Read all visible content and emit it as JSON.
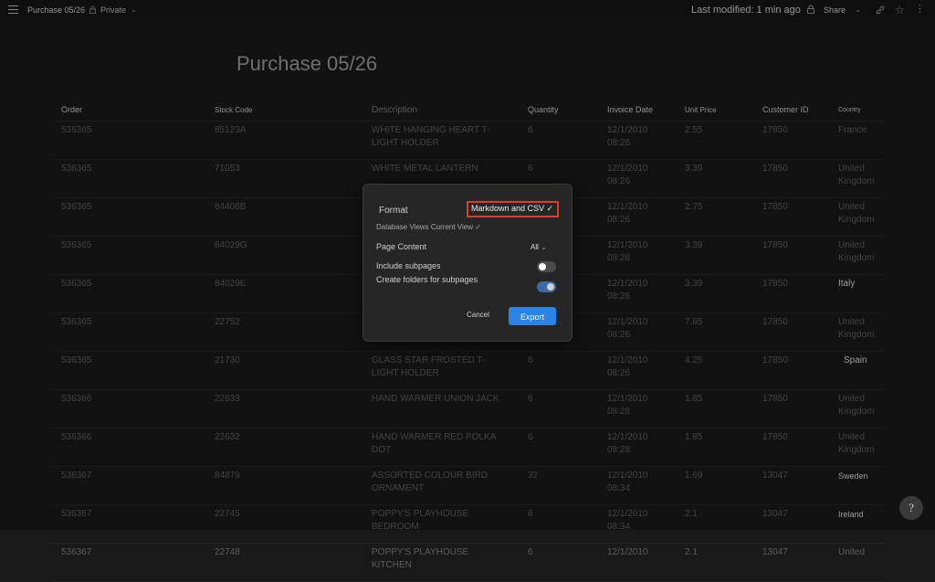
{
  "topbar": {
    "breadcrumb": "Purchase 05/26",
    "privacy": "Private",
    "last_modified": "Last modified: 1 min ago",
    "share_label": "Share",
    "icons": [
      "menu-icon",
      "lock-icon",
      "chevron-down-icon",
      "share-lock-icon",
      "link-icon",
      "star-icon",
      "more-icon"
    ]
  },
  "page": {
    "title": "Purchase 05/26"
  },
  "table": {
    "headers": [
      "Order",
      "Stock Code",
      "Description",
      "Quantity",
      "Invoice Date",
      "Unit Price",
      "Customer ID",
      "Country"
    ],
    "rows": [
      {
        "order": "536365",
        "code": "85123A",
        "desc": "WHITE HANGING HEART T-LIGHT HOLDER",
        "qty": "6",
        "date": "12/1/2010 08:26",
        "price": "2.55",
        "cust": "17850",
        "country": "France"
      },
      {
        "order": "536365",
        "code": "71053",
        "desc": "WHITE METAL LANTERN",
        "qty": "6",
        "date": "12/1/2010 08:26",
        "price": "3.39",
        "cust": "17850",
        "country": "United Kingdom"
      },
      {
        "order": "536365",
        "code": "84406B",
        "desc": "",
        "qty": "",
        "date": "12/1/2010 08:26",
        "price": "2.75",
        "cust": "17850",
        "country": "United Kingdom"
      },
      {
        "order": "536365",
        "code": "84029G",
        "desc": "",
        "qty": "",
        "date": "12/1/2010 08:26",
        "price": "3.39",
        "cust": "17850",
        "country": "United Kingdom"
      },
      {
        "order": "536365",
        "code": "84029E",
        "desc": "",
        "qty": "",
        "date": "12/1/2010 08:26",
        "price": "3.39",
        "cust": "17850",
        "country": "Italy"
      },
      {
        "order": "536365",
        "code": "22752",
        "desc": "",
        "qty": "",
        "date": "12/1/2010 08:26",
        "price": "7.65",
        "cust": "17850",
        "country": "United Kingdom"
      },
      {
        "order": "536365",
        "code": "21730",
        "desc": "GLASS STAR FROSTED T-LIGHT HOLDER",
        "qty": "6",
        "date": "12/1/2010 08:26",
        "price": "4.25",
        "cust": "17850",
        "country": "Spain"
      },
      {
        "order": "536366",
        "code": "22633",
        "desc": "HAND WARMER UNION JACK",
        "qty": "6",
        "date": "12/1/2010 08:28",
        "price": "1.85",
        "cust": "17850",
        "country": "United Kingdom"
      },
      {
        "order": "536366",
        "code": "22632",
        "desc": "HAND WARMER RED POLKA DOT",
        "qty": "6",
        "date": "12/1/2010 08:28",
        "price": "1.85",
        "cust": "17850",
        "country": "United Kingdom"
      },
      {
        "order": "536367",
        "code": "84879",
        "desc": "ASSORTED COLOUR BIRD ORNAMENT",
        "qty": "32",
        "date": "12/1/2010 08:34",
        "price": "1.69",
        "cust": "13047",
        "country": "Sweden"
      },
      {
        "order": "536367",
        "code": "22745",
        "desc": "POPPY'S PLAYHOUSE BEDROOM",
        "qty": "6",
        "date": "12/1/2010 08:34",
        "price": "2.1",
        "cust": "13047",
        "country": "Ireland"
      },
      {
        "order": "536367",
        "code": "22748",
        "desc": "POPPY'S PLAYHOUSE KITCHEN",
        "qty": "6",
        "date": "12/1/2010",
        "price": "2.1",
        "cust": "13047",
        "country": "United"
      }
    ]
  },
  "export_dialog": {
    "format_label": "Format",
    "format_value": "Markdown and CSV",
    "database_views": "Database Views Current View",
    "page_content_label": "Page Content",
    "page_content_value": "All",
    "include_subpages_label": "Include subpages",
    "include_subpages_on": false,
    "create_folders_label": "Create folders for subpages",
    "create_folders_on": true,
    "cancel_label": "Cancel",
    "export_label": "Export",
    "accent_color": "#2a84e6",
    "highlight_color": "#e03a2a"
  },
  "help_label": "?"
}
